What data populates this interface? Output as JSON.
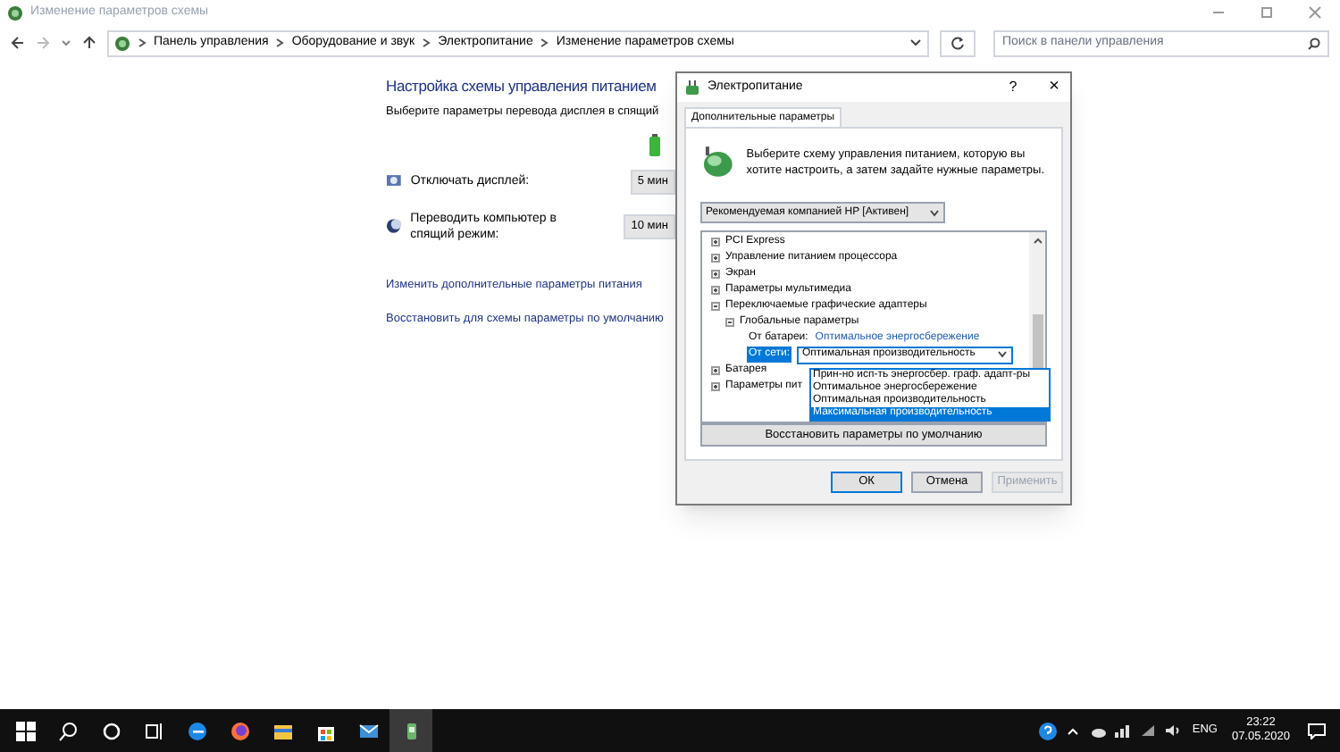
{
  "window": {
    "title": "Изменение параметров схемы"
  },
  "address_bar": {
    "crumbs": [
      "Панель управления",
      "Оборудование и звук",
      "Электропитание",
      "Изменение параметров схемы"
    ]
  },
  "search": {
    "placeholder": "Поиск в панели управления"
  },
  "page": {
    "title": "Настройка схемы управления питанием",
    "subtitle": "Выберите параметры перевода дисплея в спящий",
    "settings": [
      {
        "kind": "display",
        "label": "Отключать дисплей:",
        "value": "5 мин"
      },
      {
        "kind": "sleep",
        "label": "Переводить компьютер в спящий режим:",
        "value": "10 мин"
      }
    ],
    "links": [
      "Изменить дополнительные параметры питания",
      "Восстановить для схемы параметры по умолчанию"
    ]
  },
  "dialog": {
    "title": "Электропитание",
    "help": "?",
    "close": "×",
    "tabs": [
      {
        "label": "Дополнительные параметры",
        "selected": true
      }
    ],
    "description": "Выберите схему управления питанием, которую вы хотите настроить, а затем задайте нужные параметры.",
    "scheme": "Рекомендуемая компанией HP [Активен]",
    "tree": [
      {
        "label": "PCI Express",
        "expanded": false
      },
      {
        "label": "Управление питанием процессора",
        "expanded": false
      },
      {
        "label": "Экран",
        "expanded": false
      },
      {
        "label": "Параметры мультимедиа",
        "expanded": false
      },
      {
        "label": "Переключаемые графические адаптеры",
        "expanded": true,
        "children": [
          {
            "label": "Глобальные параметры",
            "expanded": true,
            "children": [
              {
                "kind": "setting",
                "label": "От батареи:",
                "value": "Оптимальное энергосбережение",
                "selected": false
              },
              {
                "kind": "setting",
                "label": "От сети:",
                "value": "Оптимальная производительность",
                "selected": true
              }
            ]
          }
        ]
      },
      {
        "label": "Батарея",
        "expanded": false
      },
      {
        "label": "Параметры пит",
        "expanded": false
      }
    ],
    "options": [
      {
        "label": "Прин-но исп-ть энергосбер. граф. адапт-ры",
        "selected": false
      },
      {
        "label": "Оптимальное энергосбережение",
        "selected": false
      },
      {
        "label": "Оптимальная производительность",
        "selected": false
      },
      {
        "label": "Максимальная производительность",
        "selected": true
      }
    ],
    "restore_button": "Восстановить параметры по умолчанию",
    "buttons": [
      {
        "label": "ОК",
        "disabled": false,
        "default": true
      },
      {
        "label": "Отмена",
        "disabled": false,
        "default": false
      },
      {
        "label": "Применить",
        "disabled": true,
        "default": false
      }
    ]
  },
  "taskbar": {
    "language": "ENG",
    "time": "23:22",
    "date": "07.05.2020"
  }
}
